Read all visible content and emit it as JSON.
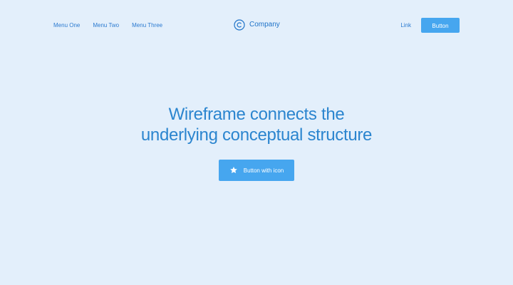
{
  "header": {
    "menu": [
      {
        "label": "Menu One"
      },
      {
        "label": "Menu Two"
      },
      {
        "label": "Menu Three"
      }
    ],
    "brand": {
      "icon": "copyright-icon",
      "name": "Company"
    },
    "link_label": "Link",
    "button_label": "Button"
  },
  "hero": {
    "title_line_1": "Wireframe connects the",
    "title_line_2": "underlying conceptual structure",
    "cta_label": "Button with icon",
    "cta_icon": "star-icon"
  },
  "colors": {
    "background": "#e3effb",
    "accent": "#46a6ef",
    "text": "#2b85cf"
  }
}
